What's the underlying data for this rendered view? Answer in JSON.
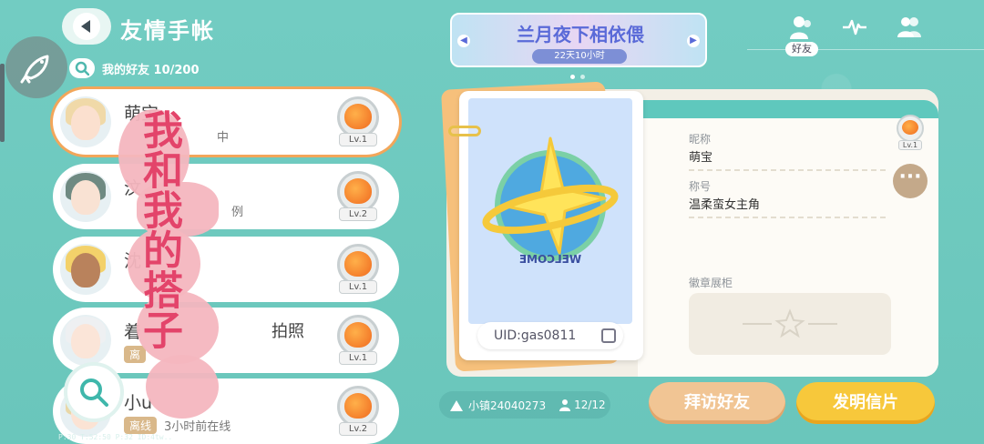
{
  "header": {
    "title": "友情手帐",
    "friends_count_label": "我的好友 10/200"
  },
  "friends": [
    {
      "name": "萌宝",
      "status_tag": "",
      "status_text": "中",
      "level": "Lv.1",
      "selected": true
    },
    {
      "name": "汶",
      "status_tag": "",
      "status_text": "例",
      "level": "Lv.2",
      "selected": false
    },
    {
      "name": "沈",
      "status_tag": "",
      "status_text": "",
      "level": "Lv.1",
      "selected": false
    },
    {
      "name": "着",
      "status_tag": "离",
      "status_text": "拍照",
      "level": "Lv.1",
      "selected": false
    },
    {
      "name": "小u",
      "status_tag": "离线",
      "status_text": "3小时前在线",
      "level": "Lv.2",
      "selected": false
    }
  ],
  "overlay_text": "我和我的搭子",
  "debug_line": "P:30  T:52:50  P:32  ID:4tw..",
  "banner": {
    "title": "兰月夜下相依偎",
    "subtitle": "22天10小时"
  },
  "tabs": {
    "active_label": "好友"
  },
  "card": {
    "uid": "UID:gas0811",
    "welcome_text": "WELCOME",
    "nickname_label": "昵称",
    "nickname_value": "萌宝",
    "title_label": "称号",
    "title_value": "温柔蛮女主角",
    "showcase_label": "徽章展柜",
    "mini_level": "Lv.1",
    "more_icon": "···"
  },
  "bottom": {
    "town": "小镇24040273",
    "players": "12/12",
    "visit_label": "拜访好友",
    "send_label": "发明信片"
  },
  "colors": {
    "background": "#6fcac0",
    "accent_orange": "#f2a65a",
    "overlay_red": "#e3446a",
    "button_yellow": "#f7c83b"
  }
}
